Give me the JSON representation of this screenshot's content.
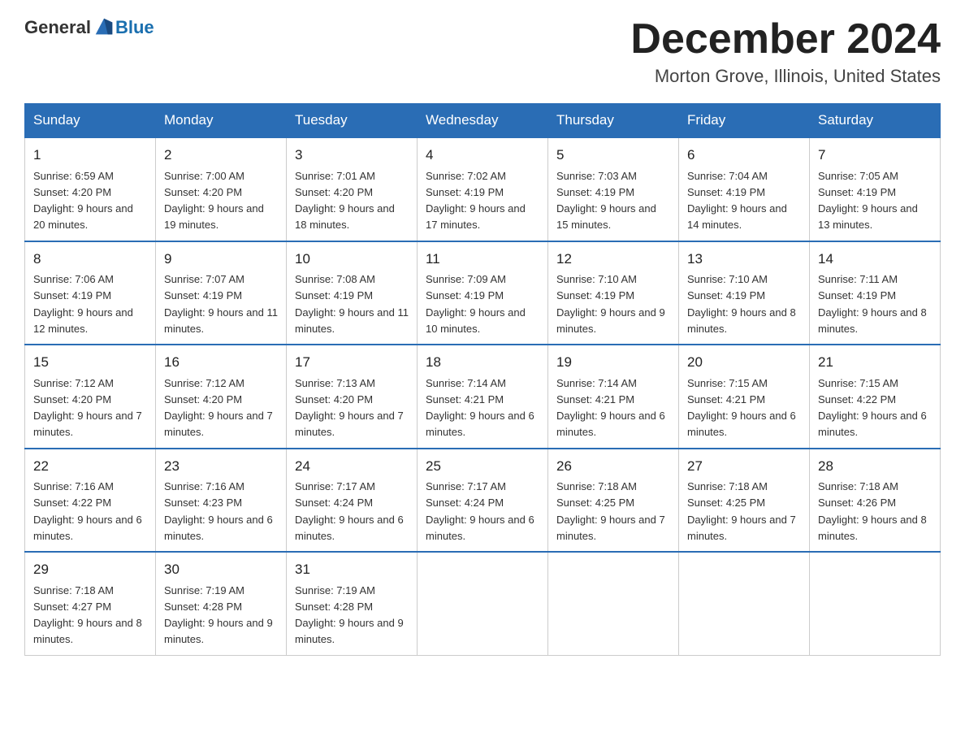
{
  "header": {
    "logo_general": "General",
    "logo_blue": "Blue",
    "title": "December 2024",
    "subtitle": "Morton Grove, Illinois, United States"
  },
  "days_of_week": [
    "Sunday",
    "Monday",
    "Tuesday",
    "Wednesday",
    "Thursday",
    "Friday",
    "Saturday"
  ],
  "weeks": [
    [
      {
        "day": "1",
        "sunrise": "6:59 AM",
        "sunset": "4:20 PM",
        "daylight": "9 hours and 20 minutes."
      },
      {
        "day": "2",
        "sunrise": "7:00 AM",
        "sunset": "4:20 PM",
        "daylight": "9 hours and 19 minutes."
      },
      {
        "day": "3",
        "sunrise": "7:01 AM",
        "sunset": "4:20 PM",
        "daylight": "9 hours and 18 minutes."
      },
      {
        "day": "4",
        "sunrise": "7:02 AM",
        "sunset": "4:19 PM",
        "daylight": "9 hours and 17 minutes."
      },
      {
        "day": "5",
        "sunrise": "7:03 AM",
        "sunset": "4:19 PM",
        "daylight": "9 hours and 15 minutes."
      },
      {
        "day": "6",
        "sunrise": "7:04 AM",
        "sunset": "4:19 PM",
        "daylight": "9 hours and 14 minutes."
      },
      {
        "day": "7",
        "sunrise": "7:05 AM",
        "sunset": "4:19 PM",
        "daylight": "9 hours and 13 minutes."
      }
    ],
    [
      {
        "day": "8",
        "sunrise": "7:06 AM",
        "sunset": "4:19 PM",
        "daylight": "9 hours and 12 minutes."
      },
      {
        "day": "9",
        "sunrise": "7:07 AM",
        "sunset": "4:19 PM",
        "daylight": "9 hours and 11 minutes."
      },
      {
        "day": "10",
        "sunrise": "7:08 AM",
        "sunset": "4:19 PM",
        "daylight": "9 hours and 11 minutes."
      },
      {
        "day": "11",
        "sunrise": "7:09 AM",
        "sunset": "4:19 PM",
        "daylight": "9 hours and 10 minutes."
      },
      {
        "day": "12",
        "sunrise": "7:10 AM",
        "sunset": "4:19 PM",
        "daylight": "9 hours and 9 minutes."
      },
      {
        "day": "13",
        "sunrise": "7:10 AM",
        "sunset": "4:19 PM",
        "daylight": "9 hours and 8 minutes."
      },
      {
        "day": "14",
        "sunrise": "7:11 AM",
        "sunset": "4:19 PM",
        "daylight": "9 hours and 8 minutes."
      }
    ],
    [
      {
        "day": "15",
        "sunrise": "7:12 AM",
        "sunset": "4:20 PM",
        "daylight": "9 hours and 7 minutes."
      },
      {
        "day": "16",
        "sunrise": "7:12 AM",
        "sunset": "4:20 PM",
        "daylight": "9 hours and 7 minutes."
      },
      {
        "day": "17",
        "sunrise": "7:13 AM",
        "sunset": "4:20 PM",
        "daylight": "9 hours and 7 minutes."
      },
      {
        "day": "18",
        "sunrise": "7:14 AM",
        "sunset": "4:21 PM",
        "daylight": "9 hours and 6 minutes."
      },
      {
        "day": "19",
        "sunrise": "7:14 AM",
        "sunset": "4:21 PM",
        "daylight": "9 hours and 6 minutes."
      },
      {
        "day": "20",
        "sunrise": "7:15 AM",
        "sunset": "4:21 PM",
        "daylight": "9 hours and 6 minutes."
      },
      {
        "day": "21",
        "sunrise": "7:15 AM",
        "sunset": "4:22 PM",
        "daylight": "9 hours and 6 minutes."
      }
    ],
    [
      {
        "day": "22",
        "sunrise": "7:16 AM",
        "sunset": "4:22 PM",
        "daylight": "9 hours and 6 minutes."
      },
      {
        "day": "23",
        "sunrise": "7:16 AM",
        "sunset": "4:23 PM",
        "daylight": "9 hours and 6 minutes."
      },
      {
        "day": "24",
        "sunrise": "7:17 AM",
        "sunset": "4:24 PM",
        "daylight": "9 hours and 6 minutes."
      },
      {
        "day": "25",
        "sunrise": "7:17 AM",
        "sunset": "4:24 PM",
        "daylight": "9 hours and 6 minutes."
      },
      {
        "day": "26",
        "sunrise": "7:18 AM",
        "sunset": "4:25 PM",
        "daylight": "9 hours and 7 minutes."
      },
      {
        "day": "27",
        "sunrise": "7:18 AM",
        "sunset": "4:25 PM",
        "daylight": "9 hours and 7 minutes."
      },
      {
        "day": "28",
        "sunrise": "7:18 AM",
        "sunset": "4:26 PM",
        "daylight": "9 hours and 8 minutes."
      }
    ],
    [
      {
        "day": "29",
        "sunrise": "7:18 AM",
        "sunset": "4:27 PM",
        "daylight": "9 hours and 8 minutes."
      },
      {
        "day": "30",
        "sunrise": "7:19 AM",
        "sunset": "4:28 PM",
        "daylight": "9 hours and 9 minutes."
      },
      {
        "day": "31",
        "sunrise": "7:19 AM",
        "sunset": "4:28 PM",
        "daylight": "9 hours and 9 minutes."
      },
      null,
      null,
      null,
      null
    ]
  ],
  "labels": {
    "sunrise_prefix": "Sunrise: ",
    "sunset_prefix": "Sunset: ",
    "daylight_prefix": "Daylight: "
  }
}
